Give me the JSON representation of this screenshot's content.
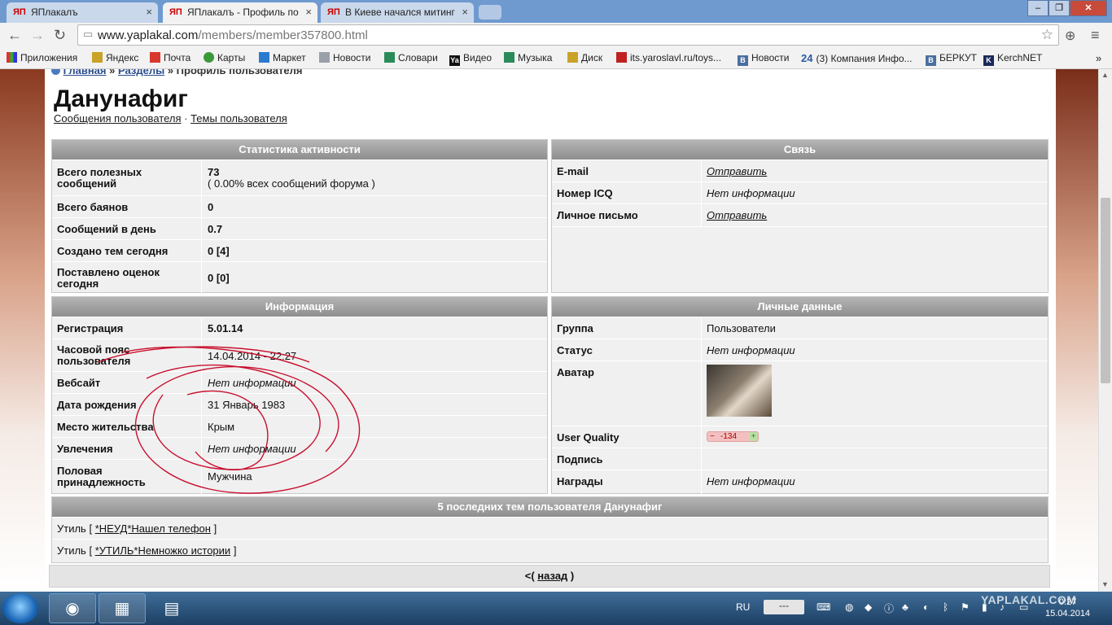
{
  "browser": {
    "tabs": [
      {
        "title": "ЯПлакалъ",
        "favicon": "ЯП"
      },
      {
        "title": "ЯПлакалъ - Профиль по",
        "favicon": "ЯП"
      },
      {
        "title": "В Киеве начался митинг",
        "favicon": "ЯП"
      }
    ],
    "url_host": "www.yaplakal.com",
    "url_path": "/members/member357800.html",
    "bookmarks": [
      "Приложения",
      "Яндекс",
      "Почта",
      "Карты",
      "Маркет",
      "Новости",
      "Словари",
      "Видео",
      "Музыка",
      "Диск",
      "its.yaroslavl.ru/toys...",
      "Новости",
      "(3) Компания Инфо...",
      "БЕРКУТ",
      "KerchNET"
    ],
    "bookmark_prefix_24": "24"
  },
  "page": {
    "breadcrumb": {
      "home": "Главная",
      "sep1": "»",
      "sections": "Разделы",
      "sep2": "»",
      "current": "Профиль пользователя"
    },
    "username": "Данунафиг",
    "links": {
      "messages": "Сообщения пользователя",
      "dot": "·",
      "topics": "Темы пользователя"
    },
    "stats": {
      "title": "Статистика активности",
      "rows": [
        {
          "label": "Всего полезных сообщений",
          "value": "73",
          "sub": "( 0.00% всех сообщений форума )"
        },
        {
          "label": "Всего баянов",
          "value": "0"
        },
        {
          "label": "Сообщений в день",
          "value": "0.7"
        },
        {
          "label": "Создано тем сегодня",
          "value": "0 [4]"
        },
        {
          "label": "Поставлено оценок сегодня",
          "value": "0 [0]"
        }
      ]
    },
    "contact": {
      "title": "Связь",
      "rows": [
        {
          "label": "E-mail",
          "value": "Отправить"
        },
        {
          "label": "Номер ICQ",
          "value": "Нет информации"
        },
        {
          "label": "Личное письмо",
          "value": "Отправить"
        }
      ]
    },
    "info": {
      "title": "Информация",
      "rows": [
        {
          "label": "Регистрация",
          "value": "5.01.14"
        },
        {
          "label": "Часовой пояс пользователя",
          "value": "14.04.2014 - 22:27"
        },
        {
          "label": "Вебсайт",
          "value": "Нет информации"
        },
        {
          "label": "Дата рождения",
          "value": "31 Январь 1983"
        },
        {
          "label": "Место жительства",
          "value": "Крым"
        },
        {
          "label": "Увлечения",
          "value": "Нет информации"
        },
        {
          "label": "Половая принадлежность",
          "value": "Мужчина"
        }
      ]
    },
    "personal": {
      "title": "Личные данные",
      "rows": [
        {
          "label": "Группа",
          "value": "Пользователи"
        },
        {
          "label": "Статус",
          "value": "Нет информации"
        },
        {
          "label": "Аватар",
          "value": ""
        },
        {
          "label": "User Quality",
          "value": "-134"
        },
        {
          "label": "Подпись",
          "value": ""
        },
        {
          "label": "Награды",
          "value": "Нет информации"
        }
      ],
      "uq_minus": "−",
      "uq_plus": "+"
    },
    "topics": {
      "title": "5 последних тем пользователя Данунафиг",
      "rows": [
        {
          "section": "Утиль",
          "open": "[",
          "link": "*НЕУД*Нашел телефон",
          "close": "]"
        },
        {
          "section": "Утиль",
          "open": "[",
          "link": "*УТИЛЬ*Немножко истории",
          "close": "]"
        }
      ]
    },
    "back": {
      "pre": "<(",
      "link": "назад",
      "post": ")"
    }
  },
  "taskbar": {
    "lang": "RU",
    "clock_time": "0:27",
    "clock_date": "15.04.2014",
    "watermark": "YAPLAKAL.COM",
    "tray_box": "---"
  },
  "colors": {
    "accent_link": "#2a4d8c",
    "panel_head": "#9e9e9e",
    "annotation": "#c8102e"
  }
}
